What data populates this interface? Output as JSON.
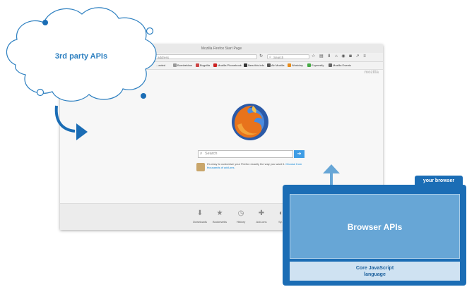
{
  "browser": {
    "window_title": "Mozilla Firefox Start Page",
    "url_placeholder": "address",
    "search_placeholder": "Search",
    "bookmarks": [
      "...ected",
      "Bornbeklow",
      "Bugzilla",
      "Mozilla Phonebook",
      "New this info",
      "Air Mozilla",
      "Workday",
      "Expensify",
      "Mozilla Events"
    ],
    "brand_label": "mozilla",
    "page_search_placeholder": "Search",
    "snippet_text": "It's easy to customize your Firefox exactly the way you want it.",
    "snippet_link": "Choose from thousands of add-ons.",
    "footer_buttons": [
      {
        "label": "Downloads",
        "icon": "download-icon"
      },
      {
        "label": "Bookmarks",
        "icon": "star-icon"
      },
      {
        "label": "History",
        "icon": "clock-icon"
      },
      {
        "label": "Add-ons",
        "icon": "puzzle-icon"
      },
      {
        "label": "Sy...",
        "icon": "sync-icon"
      }
    ]
  },
  "cloud": {
    "label": "3rd party APIs"
  },
  "your_browser": {
    "tab_label": "your browser",
    "apis_label": "Browser APIs",
    "core_line1": "Core JavaScript",
    "core_line2": "language"
  },
  "colors": {
    "primary_blue": "#1b6db5",
    "light_blue": "#67a6d6",
    "pale_blue": "#cfe2f2",
    "cloud_outline": "#2c7fc0"
  }
}
